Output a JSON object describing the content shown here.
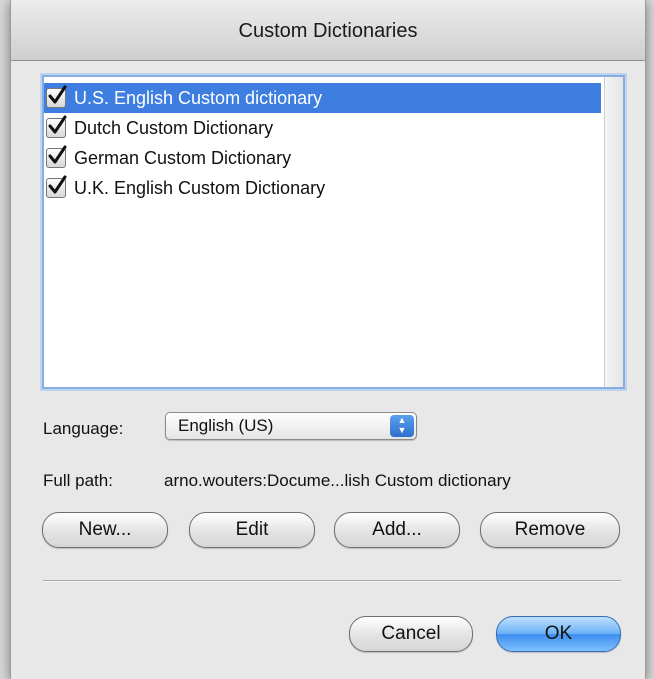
{
  "window": {
    "title": "Custom Dictionaries"
  },
  "dictionaries": [
    {
      "label": "U.S. English Custom dictionary",
      "checked": true,
      "selected": true
    },
    {
      "label": "Dutch Custom Dictionary",
      "checked": true,
      "selected": false
    },
    {
      "label": "German Custom Dictionary",
      "checked": true,
      "selected": false
    },
    {
      "label": "U.K. English Custom Dictionary",
      "checked": true,
      "selected": false
    }
  ],
  "language": {
    "label": "Language:",
    "selected": "English (US)"
  },
  "full_path": {
    "label": "Full path:",
    "value": "arno.wouters:Docume...lish Custom dictionary"
  },
  "buttons": {
    "new": "New...",
    "edit": "Edit",
    "add": "Add...",
    "remove": "Remove",
    "cancel": "Cancel",
    "ok": "OK"
  },
  "colors": {
    "selection": "#3d7ee0",
    "default_button": "#3d8ef0",
    "focus_ring": "#86aee0"
  },
  "icons": {
    "checkbox_mark": "checkmark-icon",
    "popup_arrows": "updown-arrows-icon"
  }
}
